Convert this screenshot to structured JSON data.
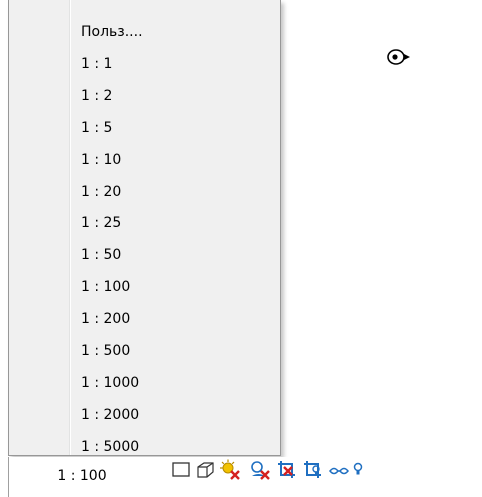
{
  "scale_menu": {
    "items": [
      {
        "label": "Польз...."
      },
      {
        "label": "1 : 1"
      },
      {
        "label": "1 : 2"
      },
      {
        "label": "1 : 5"
      },
      {
        "label": "1 : 10"
      },
      {
        "label": "1 : 20"
      },
      {
        "label": "1 : 25"
      },
      {
        "label": "1 : 50"
      },
      {
        "label": "1 : 100"
      },
      {
        "label": "1 : 200"
      },
      {
        "label": "1 : 500"
      },
      {
        "label": "1 : 1000"
      },
      {
        "label": "1 : 2000"
      },
      {
        "label": "1 : 5000"
      }
    ]
  },
  "status_bar": {
    "scale_value": "1 : 100",
    "icons": [
      "detail-level-icon",
      "visual-style-cube-icon",
      "sun-path-off-icon",
      "shadows-off-icon",
      "crop-view-off-icon",
      "show-crop-region-icon",
      "temporary-hide-icon",
      "reveal-hidden-icon"
    ]
  },
  "canvas": {
    "cursor_icon": "eye-orbit-cursor-icon"
  },
  "colors": {
    "menu_bg": "#f0f0f0",
    "menu_border": "#979797",
    "icon_blue": "#1f6fc1",
    "icon_red": "#d42020",
    "icon_yellow": "#f2c200"
  }
}
